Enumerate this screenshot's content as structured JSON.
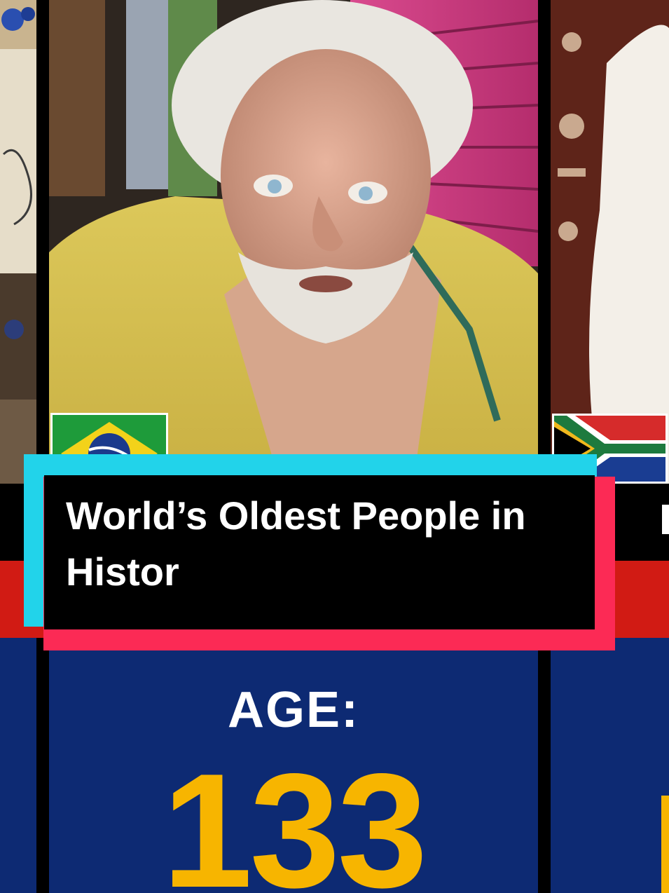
{
  "title_overlay": {
    "text": "World’s Oldest People in Histor"
  },
  "main_card": {
    "flag": "brazil-flag",
    "age_label": "AGE:",
    "age_value": "133"
  },
  "right_card": {
    "flag": "south-africa-flag"
  },
  "colors": {
    "title_cyan": "#22d3ea",
    "title_red": "#fc2a55",
    "age_panel_blue": "#0d2a73",
    "age_value_yellow": "#f7b500",
    "strip_red": "#d11b14"
  }
}
